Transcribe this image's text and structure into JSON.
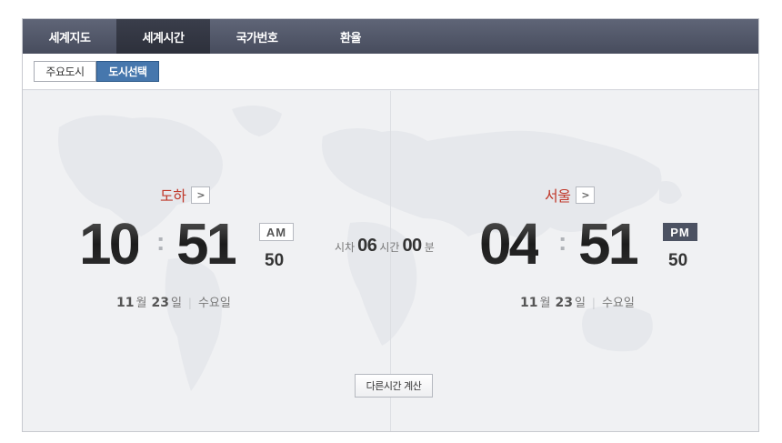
{
  "tabs": [
    {
      "label": "세계지도"
    },
    {
      "label": "세계시간"
    },
    {
      "label": "국가번호"
    },
    {
      "label": "환율"
    }
  ],
  "active_tab": "세계시간",
  "subtabs": [
    {
      "label": "주요도시"
    },
    {
      "label": "도시선택"
    }
  ],
  "active_subtab": "도시선택",
  "left_clock": {
    "city": "도하",
    "hour": "10",
    "minute": "51",
    "ampm": "AM",
    "second": "50",
    "month": "11",
    "month_unit": "월",
    "day": "23",
    "day_unit": "일",
    "weekday": "수요일"
  },
  "right_clock": {
    "city": "서울",
    "hour": "04",
    "minute": "51",
    "ampm": "PM",
    "second": "50",
    "month": "11",
    "month_unit": "월",
    "day": "23",
    "day_unit": "일",
    "weekday": "수요일"
  },
  "time_difference": {
    "prefix": "시차",
    "hours": "06",
    "hours_unit": "시간",
    "minutes": "00",
    "minutes_unit": "분"
  },
  "calc_button_label": "다른시간 계산",
  "colors": {
    "tabbar": "#474c5d",
    "city_name": "#c0392b",
    "subtab_active": "#4677ad",
    "pm_badge": "#4c5262"
  },
  "icons": {
    "city_arrow": "chevron-right-icon",
    "background": "world-map"
  }
}
